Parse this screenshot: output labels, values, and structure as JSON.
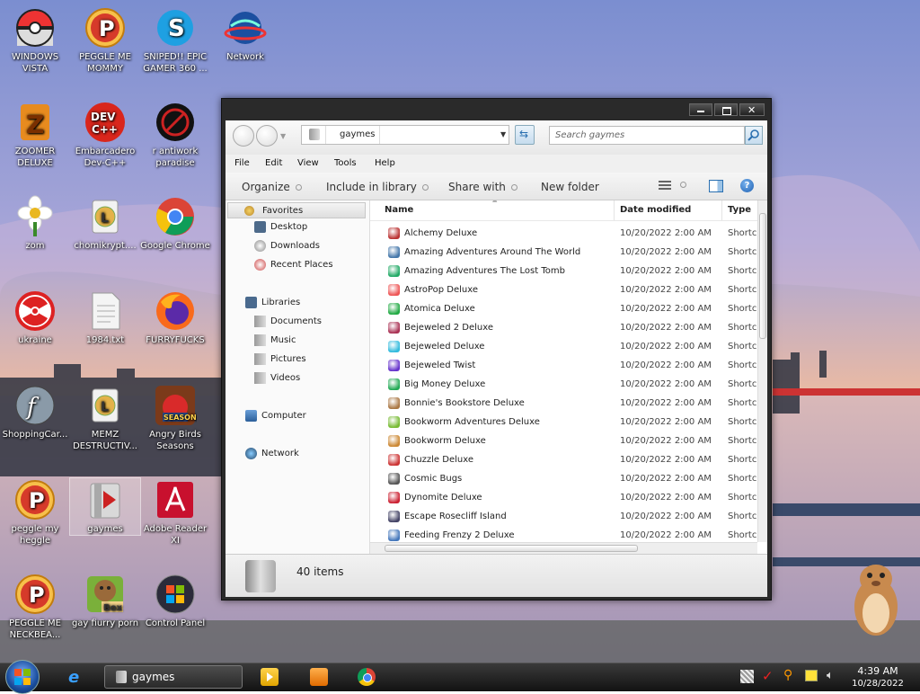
{
  "desktop": {
    "icons": [
      {
        "label": "WINDOWS VISTA",
        "icon": "pokeball-icon"
      },
      {
        "label": "PEGGLE ME MOMMY",
        "icon": "peggle-icon"
      },
      {
        "label": "SNIPED!! EPIC GAMER 360 ...",
        "icon": "skype-icon"
      },
      {
        "label": "Network",
        "icon": "network-globe-icon"
      },
      {
        "label": "ZOOMER DELUXE",
        "icon": "zoomer-icon"
      },
      {
        "label": "Embarcadero Dev-C++",
        "icon": "devcpp-icon"
      },
      {
        "label": "r antiwork paradise",
        "icon": "antiwork-icon"
      },
      {
        "label": "zom",
        "icon": "flower-icon"
      },
      {
        "label": "chomikrypt....",
        "icon": "shortcut-clock-icon"
      },
      {
        "label": "Google Chrome",
        "icon": "chrome-icon"
      },
      {
        "label": "ukraine",
        "icon": "radiation-icon"
      },
      {
        "label": "1984.txt",
        "icon": "text-file-icon"
      },
      {
        "label": "FURRYFUCKS",
        "icon": "firefox-icon"
      },
      {
        "label": "ShoppingCar...",
        "icon": "flash-icon"
      },
      {
        "label": "MEMZ DESTRUCTIV...",
        "icon": "shortcut-clock-icon"
      },
      {
        "label": "Angry Birds Seasons",
        "icon": "angry-birds-icon"
      },
      {
        "label": "peggle my heggle",
        "icon": "peggle-icon"
      },
      {
        "label": "gaymes",
        "icon": "folder-icon"
      },
      {
        "label": "Adobe Reader XI",
        "icon": "adobe-reader-icon"
      },
      {
        "label": "PEGGLE ME NECKBEA...",
        "icon": "peggle-icon"
      },
      {
        "label": "gay fiurry porn",
        "icon": "gopher-box-icon"
      },
      {
        "label": "Control Panel",
        "icon": "control-panel-icon"
      }
    ]
  },
  "window": {
    "address": "gaymes",
    "search_placeholder": "Search gaymes",
    "menu": [
      "File",
      "Edit",
      "View",
      "Tools",
      "Help"
    ],
    "commands": {
      "organize": "Organize",
      "include_in_library": "Include in library",
      "share_with": "Share with",
      "new_folder": "New folder"
    },
    "nav": {
      "favorites": "Favorites",
      "desktop": "Desktop",
      "downloads": "Downloads",
      "recent_places": "Recent Places",
      "libraries": "Libraries",
      "documents": "Documents",
      "music": "Music",
      "pictures": "Pictures",
      "videos": "Videos",
      "computer": "Computer",
      "network": "Network"
    },
    "columns": {
      "name": "Name",
      "date_modified": "Date modified",
      "type": "Type"
    },
    "files": [
      {
        "name": "Alchemy Deluxe",
        "date": "10/20/2022 2:00 AM",
        "type": "Shortc",
        "color": "#b33"
      },
      {
        "name": "Amazing Adventures Around The World",
        "date": "10/20/2022 2:00 AM",
        "type": "Shortc",
        "color": "#47a"
      },
      {
        "name": "Amazing Adventures The Lost Tomb",
        "date": "10/20/2022 2:00 AM",
        "type": "Shortc",
        "color": "#2a6"
      },
      {
        "name": "AstroPop Deluxe",
        "date": "10/20/2022 2:00 AM",
        "type": "Shortc",
        "color": "#e55"
      },
      {
        "name": "Atomica Deluxe",
        "date": "10/20/2022 2:00 AM",
        "type": "Shortc",
        "color": "#2a4"
      },
      {
        "name": "Bejeweled 2 Deluxe",
        "date": "10/20/2022 2:00 AM",
        "type": "Shortc",
        "color": "#a35"
      },
      {
        "name": "Bejeweled Deluxe",
        "date": "10/20/2022 2:00 AM",
        "type": "Shortc",
        "color": "#3bd"
      },
      {
        "name": "Bejeweled Twist",
        "date": "10/20/2022 2:00 AM",
        "type": "Shortc",
        "color": "#63c"
      },
      {
        "name": "Big Money Deluxe",
        "date": "10/20/2022 2:00 AM",
        "type": "Shortc",
        "color": "#2a5"
      },
      {
        "name": "Bonnie's Bookstore Deluxe",
        "date": "10/20/2022 2:00 AM",
        "type": "Shortc",
        "color": "#a74"
      },
      {
        "name": "Bookworm Adventures Deluxe",
        "date": "10/20/2022 2:00 AM",
        "type": "Shortc",
        "color": "#7b3"
      },
      {
        "name": "Bookworm Deluxe",
        "date": "10/20/2022 2:00 AM",
        "type": "Shortc",
        "color": "#c83"
      },
      {
        "name": "Chuzzle Deluxe",
        "date": "10/20/2022 2:00 AM",
        "type": "Shortc",
        "color": "#c33"
      },
      {
        "name": "Cosmic Bugs",
        "date": "10/20/2022 2:00 AM",
        "type": "Shortc",
        "color": "#555"
      },
      {
        "name": "Dynomite Deluxe",
        "date": "10/20/2022 2:00 AM",
        "type": "Shortc",
        "color": "#c23"
      },
      {
        "name": "Escape Rosecliff Island",
        "date": "10/20/2022 2:00 AM",
        "type": "Shortc",
        "color": "#446"
      },
      {
        "name": "Feeding Frenzy 2 Deluxe",
        "date": "10/20/2022 2:00 AM",
        "type": "Shortc",
        "color": "#47b"
      }
    ],
    "item_count": "40 items"
  },
  "taskbar": {
    "task_label": "gaymes",
    "time": "4:39 AM",
    "date": "10/28/2022"
  }
}
